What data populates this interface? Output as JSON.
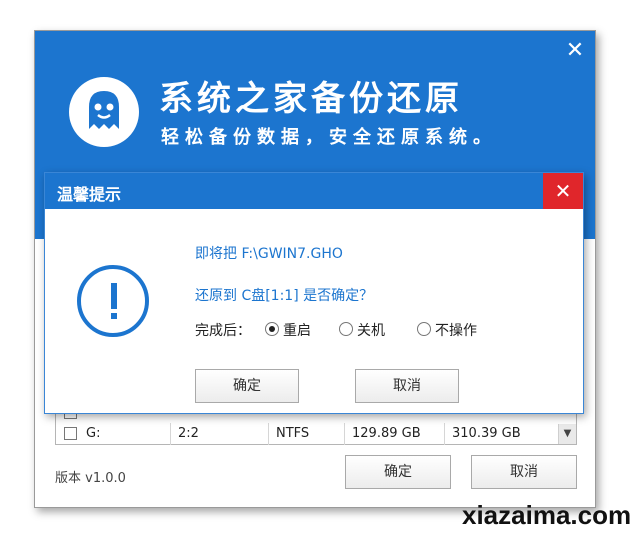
{
  "app": {
    "title": "系统之家备份还原",
    "subtitle": "轻松备份数据，安全还原系统。",
    "close_glyph": "✕",
    "logo_icon": "ghost-logo-icon"
  },
  "partition_list": {
    "rows": [
      {
        "drive": "",
        "part": "",
        "fs": "",
        "free": "",
        "total": ""
      },
      {
        "drive": "G:",
        "part": "2:2",
        "fs": "NTFS",
        "free": "129.89 GB",
        "total": "310.39 GB"
      }
    ],
    "scroll_glyph": "▼"
  },
  "footer": {
    "version": "版本 v1.0.0",
    "ok_label": "确定",
    "cancel_label": "取消"
  },
  "dialog": {
    "title": "温馨提示",
    "close_glyph": "✕",
    "line1": "即将把 F:\\GWIN7.GHO",
    "line2": "还原到 C盘[1:1] 是否确定？",
    "after_label": "完成后：",
    "options": [
      {
        "label": "重启",
        "selected": true
      },
      {
        "label": "关机",
        "selected": false
      },
      {
        "label": "不操作",
        "selected": false
      }
    ],
    "ok_label": "确定",
    "cancel_label": "取消"
  },
  "watermark": "xiazaima.com",
  "colors": {
    "header_blue": "#1c75cf",
    "close_red": "#e0262b",
    "message_blue": "#1c75cf"
  }
}
